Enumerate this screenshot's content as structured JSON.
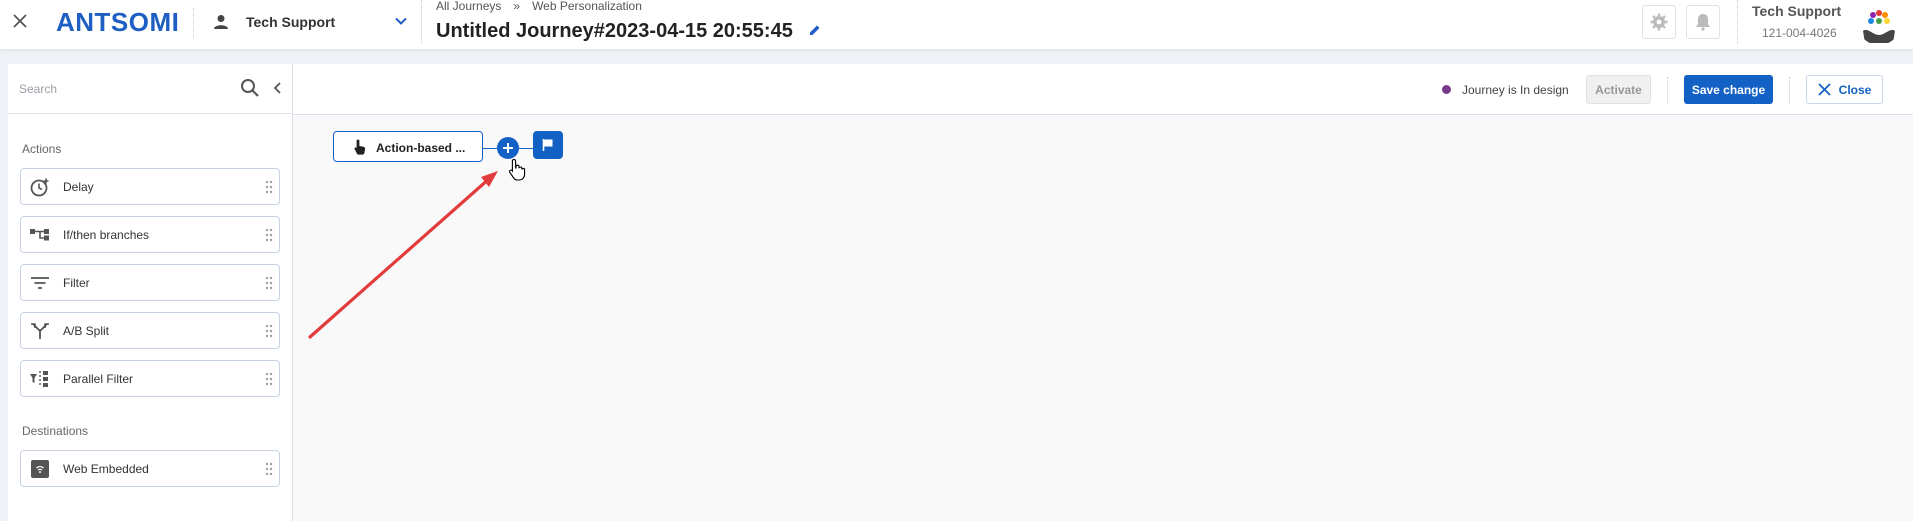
{
  "header": {
    "brand": "ANTSOMI",
    "portal_name": "Tech Support",
    "breadcrumb": [
      "All Journeys",
      "»",
      "Web Personalization"
    ],
    "journey_title": "Untitled Journey#2023-04-15 20:55:45",
    "user": {
      "name": "Tech Support",
      "id": "121-004-4026"
    },
    "icons": [
      "close-icon",
      "person-icon",
      "chevron-down-icon",
      "pencil-icon",
      "gear-icon",
      "bell-icon"
    ]
  },
  "sidebar": {
    "search": {
      "placeholder": "Search",
      "value": ""
    },
    "actions_label": "Actions",
    "actions": [
      {
        "label": "Delay",
        "icon": "clock-plus-icon"
      },
      {
        "label": "If/then branches",
        "icon": "branch-icon"
      },
      {
        "label": "Filter",
        "icon": "filter-lines-icon"
      },
      {
        "label": "A/B Split",
        "icon": "split-icon"
      },
      {
        "label": "Parallel Filter",
        "icon": "parallel-filter-icon"
      }
    ],
    "destinations_label": "Destinations",
    "destinations": [
      {
        "label": "Web Embedded",
        "icon": "web-embedded-icon"
      }
    ]
  },
  "toolbar": {
    "status_text": "Journey is In design",
    "status_color": "#7a3a8c",
    "activate_label": "Activate",
    "save_label": "Save change",
    "close_label": "Close"
  },
  "canvas": {
    "trigger_node_label": "Action-based ...",
    "accent_color": "#1361c4"
  }
}
